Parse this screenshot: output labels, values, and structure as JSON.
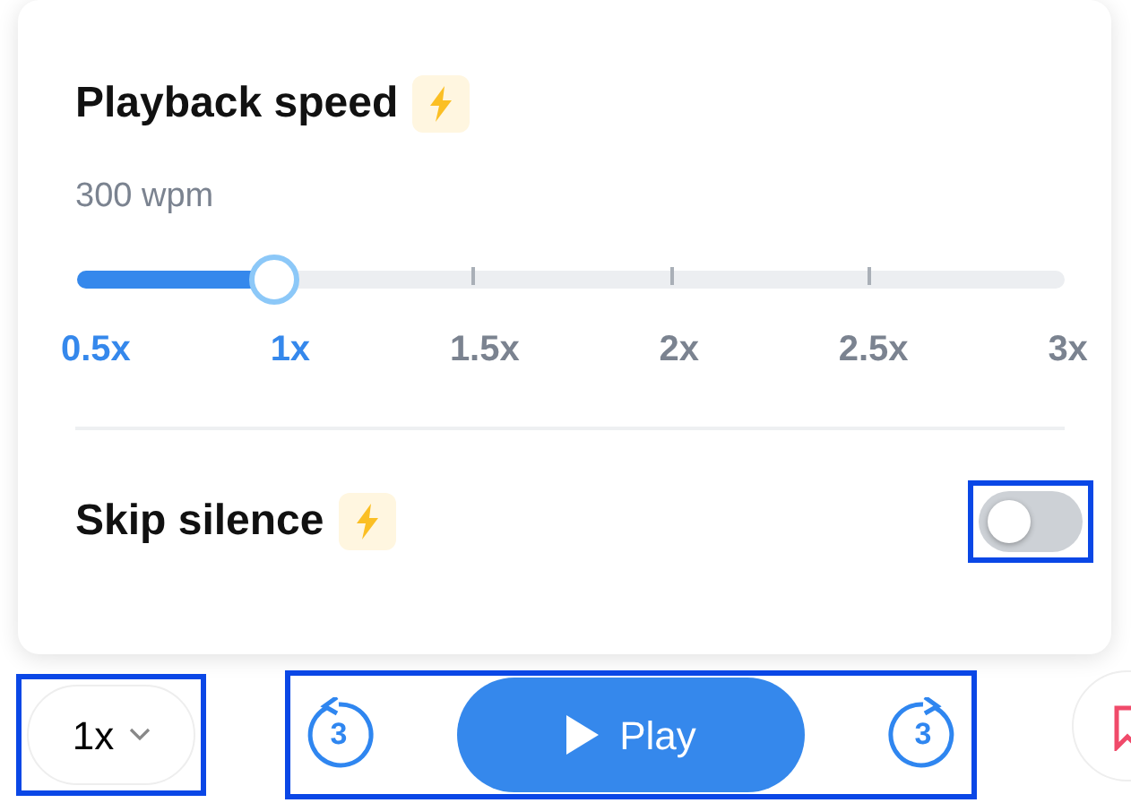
{
  "speed_panel": {
    "title": "Playback speed",
    "rate": "300 wpm",
    "level": 0.2,
    "stops": [
      {
        "label": "0.5x",
        "selected": true
      },
      {
        "label": "1x",
        "selected": true
      },
      {
        "label": "1.5x",
        "selected": false
      },
      {
        "label": "2x",
        "selected": false
      },
      {
        "label": "2.5x",
        "selected": false
      },
      {
        "label": "3x",
        "selected": false
      }
    ],
    "skip_silence": {
      "label": "Skip silence",
      "on": false,
      "highlighted": true
    }
  },
  "player_bar": {
    "speed_button": {
      "label": "1x",
      "highlighted": true
    },
    "transport": {
      "highlighted": true,
      "rewind": "3",
      "play": "Play",
      "forward": "3"
    }
  }
}
